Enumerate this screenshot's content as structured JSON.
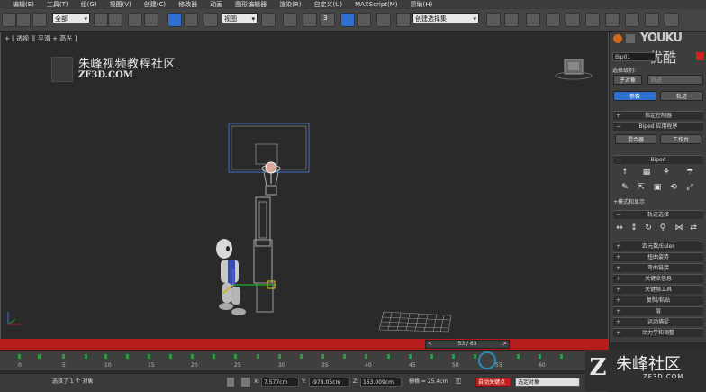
{
  "menu": [
    "编辑(E)",
    "工具(T)",
    "组(G)",
    "视图(V)",
    "创建(C)",
    "修改器",
    "动画",
    "图形编辑器",
    "渲染(R)",
    "自定义(U)",
    "MAXScript(M)",
    "帮助(H)"
  ],
  "toolbar": {
    "filter_value": "全部",
    "view_value": "视图",
    "selection_set_placeholder": "创建选择集",
    "snap_label": "3"
  },
  "viewport": {
    "label": "+ [ 透视 ][ 平滑 + 高光 ]"
  },
  "watermark": {
    "title": "朱峰视频教程社区",
    "url": "ZF3D.COM"
  },
  "youku": {
    "brand": "YOUKU",
    "cn": "优酷"
  },
  "timeline": {
    "frame_display": "53 / 63",
    "ticks": [
      "0",
      "5",
      "10",
      "15",
      "20",
      "25",
      "30",
      "35",
      "40",
      "45",
      "50",
      "55",
      "60"
    ]
  },
  "status": {
    "selection_text": "选择了 1 个 对象",
    "x_label": "X:",
    "x_value": "7.577cm",
    "y_label": "Y:",
    "y_value": "-978.05cm",
    "z_label": "Z:",
    "z_value": "163.009cm",
    "grid_label": "栅格 = 25.4cm",
    "auto_key": "自动关键点",
    "key_filter": "选定对象",
    "bottom_logo_cn": "朱峰社区",
    "bottom_logo_url": "ZF3D.COM"
  },
  "panel": {
    "object_name": "Bip01",
    "selection_level_label": "选择级别:",
    "sub_object": "子对象",
    "sub_object_value": "轨迹",
    "tab_params": "参数",
    "tab_trajectory": "轨迹",
    "rollout_assign": "指定控制器",
    "rollout_biped_app": "Biped 应用程序",
    "btn_mixer": "混合器",
    "btn_workbench": "工作台",
    "rollout_biped": "Biped",
    "modes_display": "+模式和显示",
    "rollout_track_select": "轨迹选择",
    "rollouts": [
      "四元数/Euler",
      "扭曲姿势",
      "弯曲链接",
      "关键点信息",
      "关键帧工具",
      "复制/粘贴",
      "层",
      "运动捕捉",
      "动力学和调整"
    ]
  },
  "colors": {
    "accent_blue": "#2f6fd0",
    "timeline_red": "#b51c1c",
    "auto_key_red": "#c0201e"
  }
}
